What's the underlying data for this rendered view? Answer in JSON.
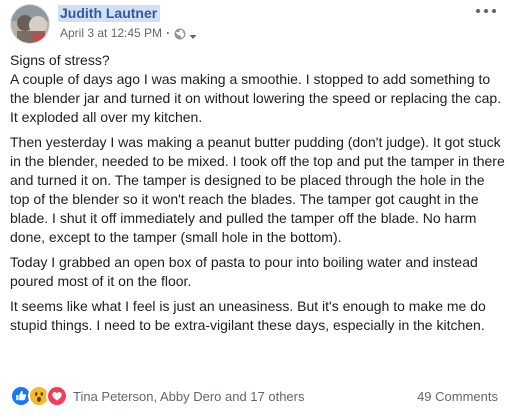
{
  "post": {
    "author": "Judith Lautner",
    "timestamp": "April 3 at 12:45 PM",
    "separator": "·",
    "privacy_icon": "globe-icon",
    "menu_icon": "more-options-icon",
    "paragraphs": [
      "Signs of stress?\nA couple of days ago I was making a smoothie. I stopped to add something to the blender jar and turned it on without lowering the speed or replacing the cap. It exploded all over my kitchen.",
      "Then yesterday I was making a peanut butter pudding (don't judge). It got stuck in the blender, needed to be mixed. I took off the top and put the tamper in there and turned it on. The tamper is designed to be placed through the hole in the top of the blender so it won't reach the blades. The tamper got caught in the blade. I shut it off immediately and pulled the tamper off the blade. No harm done, except to the tamper (small hole in the bottom).",
      "Today I grabbed an open box of pasta to pour into boiling water and instead poured most of it on the floor.",
      "It seems like what I feel is just an uneasiness. But it's enough to make me do stupid things. I need to be extra-vigilant these days, especially in the kitchen."
    ]
  },
  "footer": {
    "reactions": [
      "like-icon",
      "wow-icon",
      "love-icon"
    ],
    "reaction_names": "Tina Peterson, Abby Dero and 17 others",
    "comments": "49 Comments"
  },
  "colors": {
    "author_link": "#365899",
    "author_highlight": "#cfe0f7",
    "meta_text": "#616770",
    "like_blue": "#1877f2",
    "wow_yellow": "#f7b928",
    "love_red": "#f33e58"
  }
}
